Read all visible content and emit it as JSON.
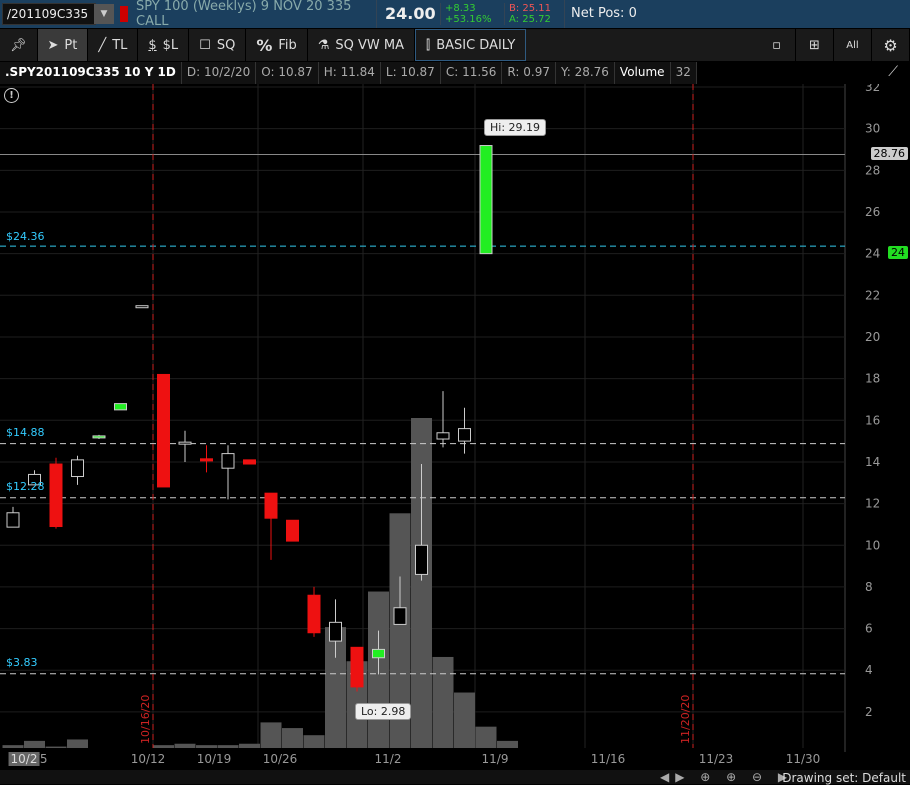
{
  "header": {
    "symbol": "/201109C335",
    "description": "SPY 100 (Weeklys) 9 NOV 20 335 CALL",
    "last": "24.00",
    "change": "+8.33",
    "change_pct": "+53.16%",
    "bid": "B: 25.11",
    "ask": "A: 25.72",
    "net_pos": "Net Pos: 0"
  },
  "toolbar": {
    "items": [
      {
        "label": "",
        "icon": "pin-icon"
      },
      {
        "label": "Pt",
        "icon": "pointer-icon"
      },
      {
        "label": "TL",
        "icon": "trendline-icon"
      },
      {
        "label": "$L",
        "icon": "price-level-icon"
      },
      {
        "label": "SQ",
        "icon": "square-icon"
      },
      {
        "label": "Fib",
        "icon": "percent-icon"
      },
      {
        "label": "SQ VW MA",
        "icon": "studies-icon"
      },
      {
        "label": "BASIC DAILY",
        "icon": "candle-style-icon"
      }
    ],
    "right": [
      "single-layout-icon",
      "grid-layout-icon",
      "All",
      "gear-icon"
    ],
    "all_label": "All"
  },
  "info": {
    "symbol": ".SPY201109C335 10 Y 1D",
    "date": "D: 10/2/20",
    "open": "O: 10.87",
    "high": "H: 11.84",
    "low": "L: 10.87",
    "close": "C: 11.56",
    "range": "R: 0.97",
    "y": "Y: 28.76",
    "volume_label": "Volume",
    "volume": "32"
  },
  "chart_data": {
    "type": "candlestick",
    "ylim": [
      0,
      32
    ],
    "yticks": [
      2,
      4,
      6,
      8,
      10,
      12,
      14,
      16,
      18,
      20,
      22,
      24,
      26,
      28,
      30,
      32
    ],
    "xlabels": [
      "10/5",
      "10/12",
      "10/19",
      "10/26",
      "11/2",
      "11/9",
      "11/16",
      "11/23",
      "11/30"
    ],
    "first_date_label": "10/2",
    "candles": [
      {
        "o": 10.87,
        "h": 11.84,
        "l": 10.87,
        "c": 11.56
      },
      {
        "o": 12.9,
        "h": 13.6,
        "l": 12.9,
        "c": 13.4
      },
      {
        "o": 13.9,
        "h": 14.2,
        "l": 10.8,
        "c": 10.9
      },
      {
        "o": 13.3,
        "h": 14.3,
        "l": 12.9,
        "c": 14.1
      },
      {
        "o": 15.2,
        "h": 15.3,
        "l": 15.1,
        "c": 15.25
      },
      {
        "o": 16.5,
        "h": 16.8,
        "l": 16.5,
        "c": 16.8
      },
      {
        "o": 21.5,
        "h": 21.5,
        "l": 21.5,
        "c": 21.5
      },
      {
        "o": 18.2,
        "h": 18.2,
        "l": 12.8,
        "c": 12.8
      },
      {
        "o": 14.9,
        "h": 15.5,
        "l": 14,
        "c": 14.95
      },
      {
        "o": 14.15,
        "h": 14.8,
        "l": 13.5,
        "c": 14.05
      },
      {
        "o": 13.7,
        "h": 14.8,
        "l": 12.2,
        "c": 14.4
      },
      {
        "o": 14.1,
        "h": 14.1,
        "l": 13.9,
        "c": 13.9
      },
      {
        "o": 12.5,
        "h": 12.5,
        "l": 9.3,
        "c": 11.3
      },
      {
        "o": 11.2,
        "h": 11.2,
        "l": 10.2,
        "c": 10.2
      },
      {
        "o": 7.6,
        "h": 8,
        "l": 5.6,
        "c": 5.8
      },
      {
        "o": 5.4,
        "h": 7.4,
        "l": 4.6,
        "c": 6.3
      },
      {
        "o": 5.1,
        "h": 5.1,
        "l": 2.98,
        "c": 3.2
      },
      {
        "o": 4.6,
        "h": 5.9,
        "l": 3.8,
        "c": 5.0
      },
      {
        "o": 6.2,
        "h": 8.5,
        "l": 6.2,
        "c": 7.0
      },
      {
        "o": 8.6,
        "h": 13.9,
        "l": 8.3,
        "c": 10.0
      },
      {
        "o": 15.1,
        "h": 17.4,
        "l": 14.7,
        "c": 15.4
      },
      {
        "o": 15.0,
        "h": 16.6,
        "l": 14.4,
        "c": 15.6
      },
      {
        "o": 24.0,
        "h": 29.19,
        "l": 24.0,
        "c": 29.19
      }
    ],
    "volume": [
      2,
      5,
      1,
      6,
      0,
      0,
      0,
      2,
      3,
      2,
      2,
      3,
      18,
      14,
      9,
      85,
      61,
      110,
      165,
      232,
      64,
      39,
      15,
      5
    ],
    "levels": [
      {
        "value": 28.76,
        "style": "solid",
        "color": "#888888"
      },
      {
        "value": 24.36,
        "label": "$24.36",
        "style": "dashed",
        "color": "#33ccee"
      },
      {
        "value": 14.88,
        "label": "$14.88",
        "style": "dashed",
        "color": "#cccccc"
      },
      {
        "value": 12.28,
        "label": "$12.28",
        "style": "dashed",
        "color": "#cccccc"
      },
      {
        "value": 3.83,
        "label": "$3.83",
        "style": "dashed",
        "color": "#cccccc"
      }
    ],
    "expirations": [
      "10/16/20",
      "11/20/20"
    ],
    "hi_label": "Hi: 29.19",
    "lo_label": "Lo: 2.98",
    "price_marker_last": "28.76",
    "price_marker_current": "24",
    "colors": {
      "up": "#22ee22",
      "down": "#ee1111",
      "volume": "#555555",
      "expiry": "#cc2222"
    }
  },
  "footer": {
    "drawing_set": "Drawing set: Default"
  }
}
